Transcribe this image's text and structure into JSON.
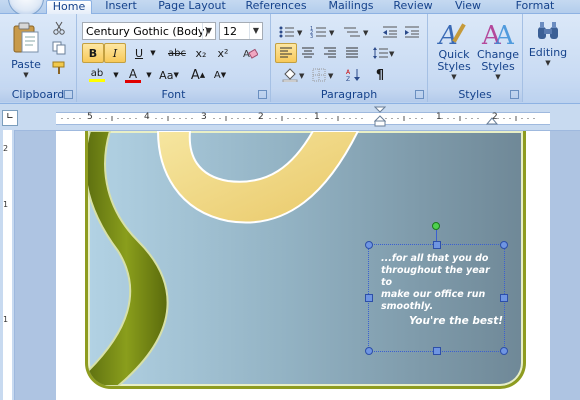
{
  "tabs": [
    {
      "label": "Home",
      "active": true
    },
    {
      "label": "Insert"
    },
    {
      "label": "Page Layout"
    },
    {
      "label": "References"
    },
    {
      "label": "Mailings"
    },
    {
      "label": "Review"
    },
    {
      "label": "View"
    },
    {
      "label": "Format"
    }
  ],
  "clipboard": {
    "group_label": "Clipboard",
    "paste_label": "Paste"
  },
  "font": {
    "group_label": "Font",
    "font_name": "Century Gothic (Body)",
    "font_size": "12",
    "bold": "B",
    "italic": "I",
    "underline": "U",
    "strike": "abc",
    "subscript": "x₂",
    "superscript": "x²",
    "grow": "A",
    "shrink": "A",
    "change_case": "Aa",
    "highlight": "ab",
    "font_color": "A"
  },
  "paragraph": {
    "group_label": "Paragraph",
    "pilcrow": "¶"
  },
  "styles": {
    "group_label": "Styles",
    "quick_styles": "Quick\nStyles",
    "change_styles": "Change\nStyles",
    "quick_line1": "Quick",
    "quick_line2": "Styles",
    "change_line1": "Change",
    "change_line2": "Styles"
  },
  "editing": {
    "label": "Editing"
  },
  "ruler": {
    "numbers": [
      "5",
      "4",
      "3",
      "2",
      "1",
      "1",
      "2"
    ],
    "vnumbers": [
      "2",
      "1",
      "1"
    ]
  },
  "textbox": {
    "line1": "...for all that you do",
    "line2": "throughout the year to",
    "line3": "make our office run",
    "line4": "smoothly.",
    "signoff": "You're the  best!"
  },
  "colors": {
    "accent_highlight": "#f8c959",
    "card_border": "#8e9c20",
    "ribbon": "#c9dbf3"
  }
}
